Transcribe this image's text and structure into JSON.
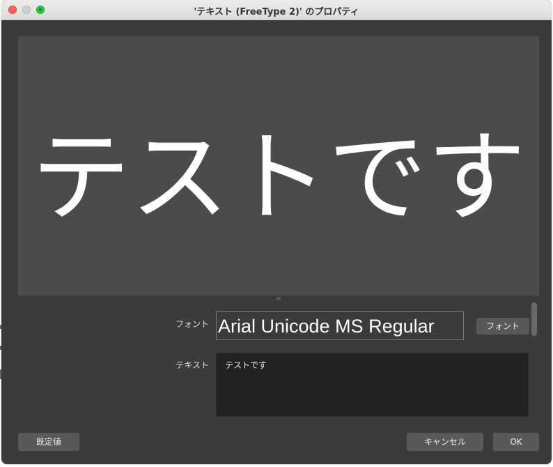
{
  "window": {
    "title": "'テキスト (FreeType 2)' のプロパティ"
  },
  "preview": {
    "text": "テストです"
  },
  "font": {
    "label": "フォント",
    "value": "Arial Unicode MS Regular",
    "button_label": "フォント"
  },
  "text": {
    "label": "テキスト",
    "value": "テストです"
  },
  "footer": {
    "defaults_label": "既定値",
    "cancel_label": "キャンセル",
    "ok_label": "OK"
  },
  "colors": {
    "window_bg": "#3b3a3c",
    "preview_bg": "#4b4b4b",
    "button_bg": "#595959",
    "text_area_bg": "#232223"
  }
}
